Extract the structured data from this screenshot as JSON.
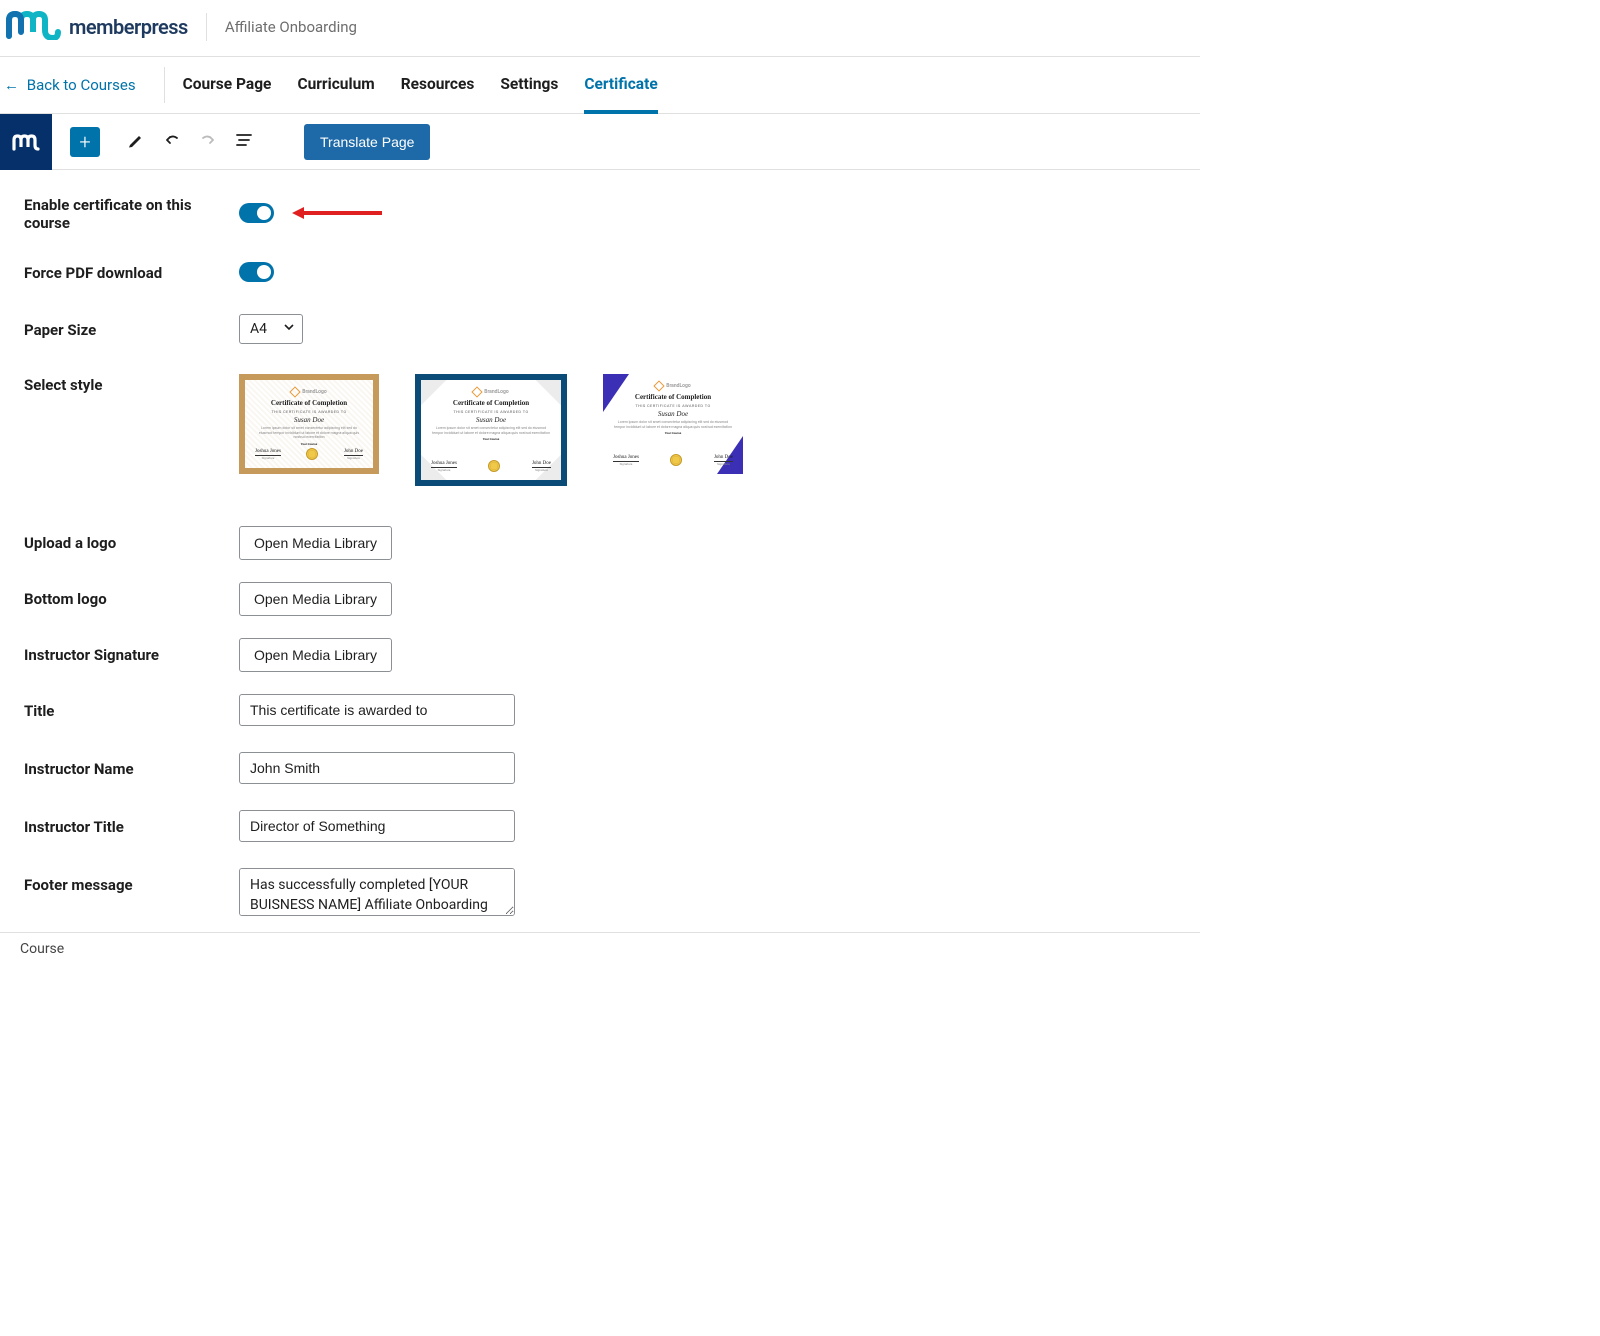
{
  "header": {
    "logo_text": "memberpress",
    "breadcrumb": "Affiliate Onboarding"
  },
  "nav": {
    "back_link": "Back to Courses",
    "tabs": [
      {
        "label": "Course Page",
        "active": false
      },
      {
        "label": "Curriculum",
        "active": false
      },
      {
        "label": "Resources",
        "active": false
      },
      {
        "label": "Settings",
        "active": false
      },
      {
        "label": "Certificate",
        "active": true
      }
    ]
  },
  "toolbar": {
    "translate_label": "Translate Page"
  },
  "form": {
    "enable_label": "Enable certificate on this course",
    "enable_value": true,
    "force_label": "Force PDF download",
    "force_value": true,
    "paper_size_label": "Paper Size",
    "paper_size_value": "A4",
    "select_style_label": "Select style",
    "cert_preview": {
      "brand": "BrandLogo",
      "title": "Certificate of Completion",
      "subtitle": "THIS CERTIFICATE IS AWARDED TO",
      "name": "Susan Doe",
      "course_label": "Your Course",
      "sig_left": "Joshua Jones",
      "sig_right": "John Doe",
      "sig_sub": "Signature"
    },
    "upload_logo_label": "Upload a logo",
    "upload_logo_btn": "Open Media Library",
    "bottom_logo_label": "Bottom logo",
    "bottom_logo_btn": "Open Media Library",
    "signature_label": "Instructor Signature",
    "signature_btn": "Open Media Library",
    "title_label": "Title",
    "title_value": "This certificate is awarded to",
    "instructor_name_label": "Instructor Name",
    "instructor_name_value": "John Smith",
    "instructor_title_label": "Instructor Title",
    "instructor_title_value": "Director of Something",
    "footer_msg_label": "Footer message",
    "footer_msg_value": "Has successfully completed [YOUR BUISNESS NAME] Affiliate Onboarding"
  },
  "footer": {
    "text": "Course"
  }
}
